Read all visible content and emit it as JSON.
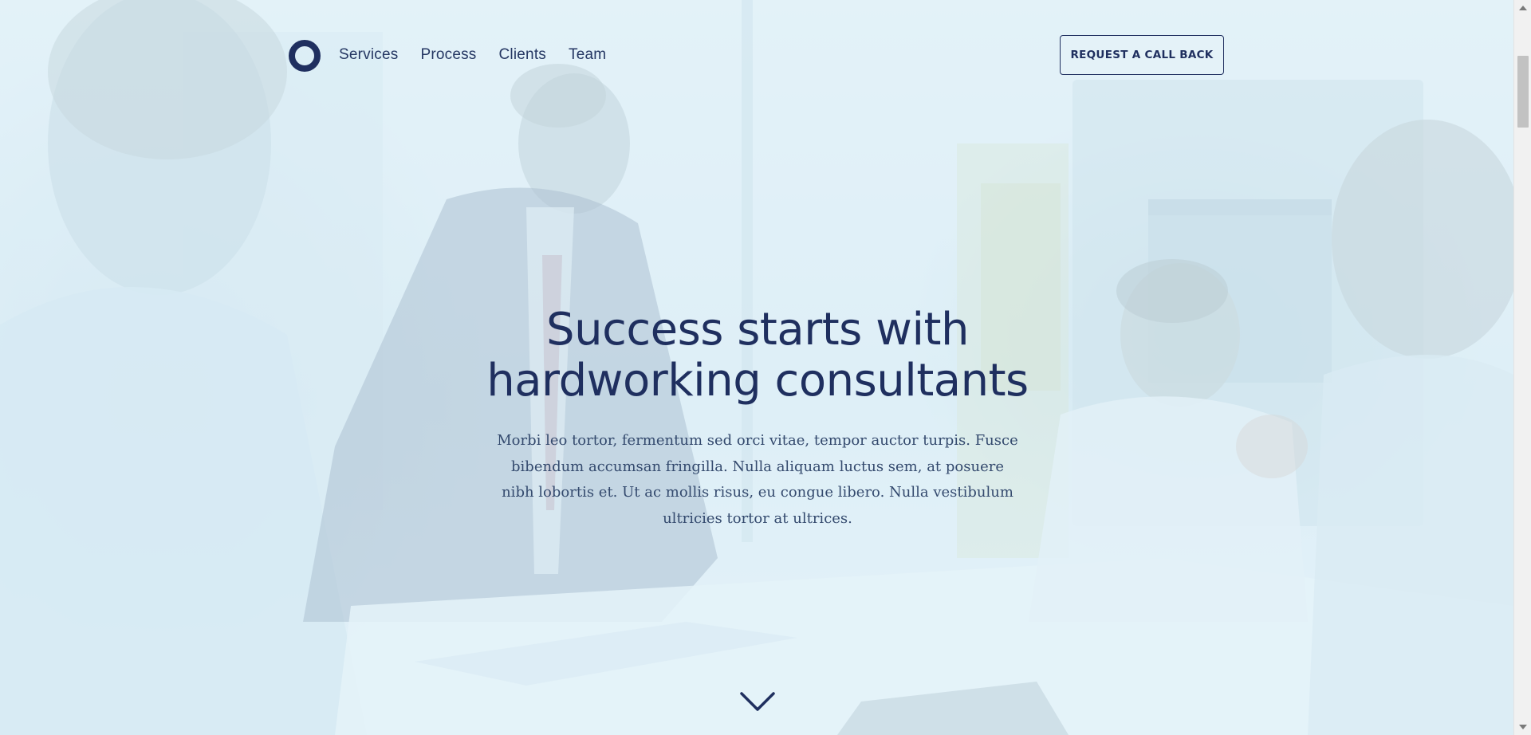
{
  "header": {
    "nav_items": [
      {
        "label": "Services"
      },
      {
        "label": "Process"
      },
      {
        "label": "Clients"
      },
      {
        "label": "Team"
      }
    ],
    "cta_label": "REQUEST A CALL BACK"
  },
  "hero": {
    "title_line_1": "Success starts with",
    "title_line_2": "hardworking consultants",
    "description": "Morbi leo tortor, fermentum sed orci vitae, tempor auctor turpis. Fusce bibendum accumsan fringilla. Nulla aliquam luctus sem, at posuere nibh lobortis et. Ut ac mollis risus, eu congue libero. Nulla vestibulum ultricies tortor at ultrices.",
    "scroll_icon": "chevron-down-icon",
    "background_icon": "office-meeting-photo"
  },
  "colors": {
    "primary": "#1f2f5f",
    "text": "#344a6e",
    "overlay": "#e2f2f9"
  }
}
